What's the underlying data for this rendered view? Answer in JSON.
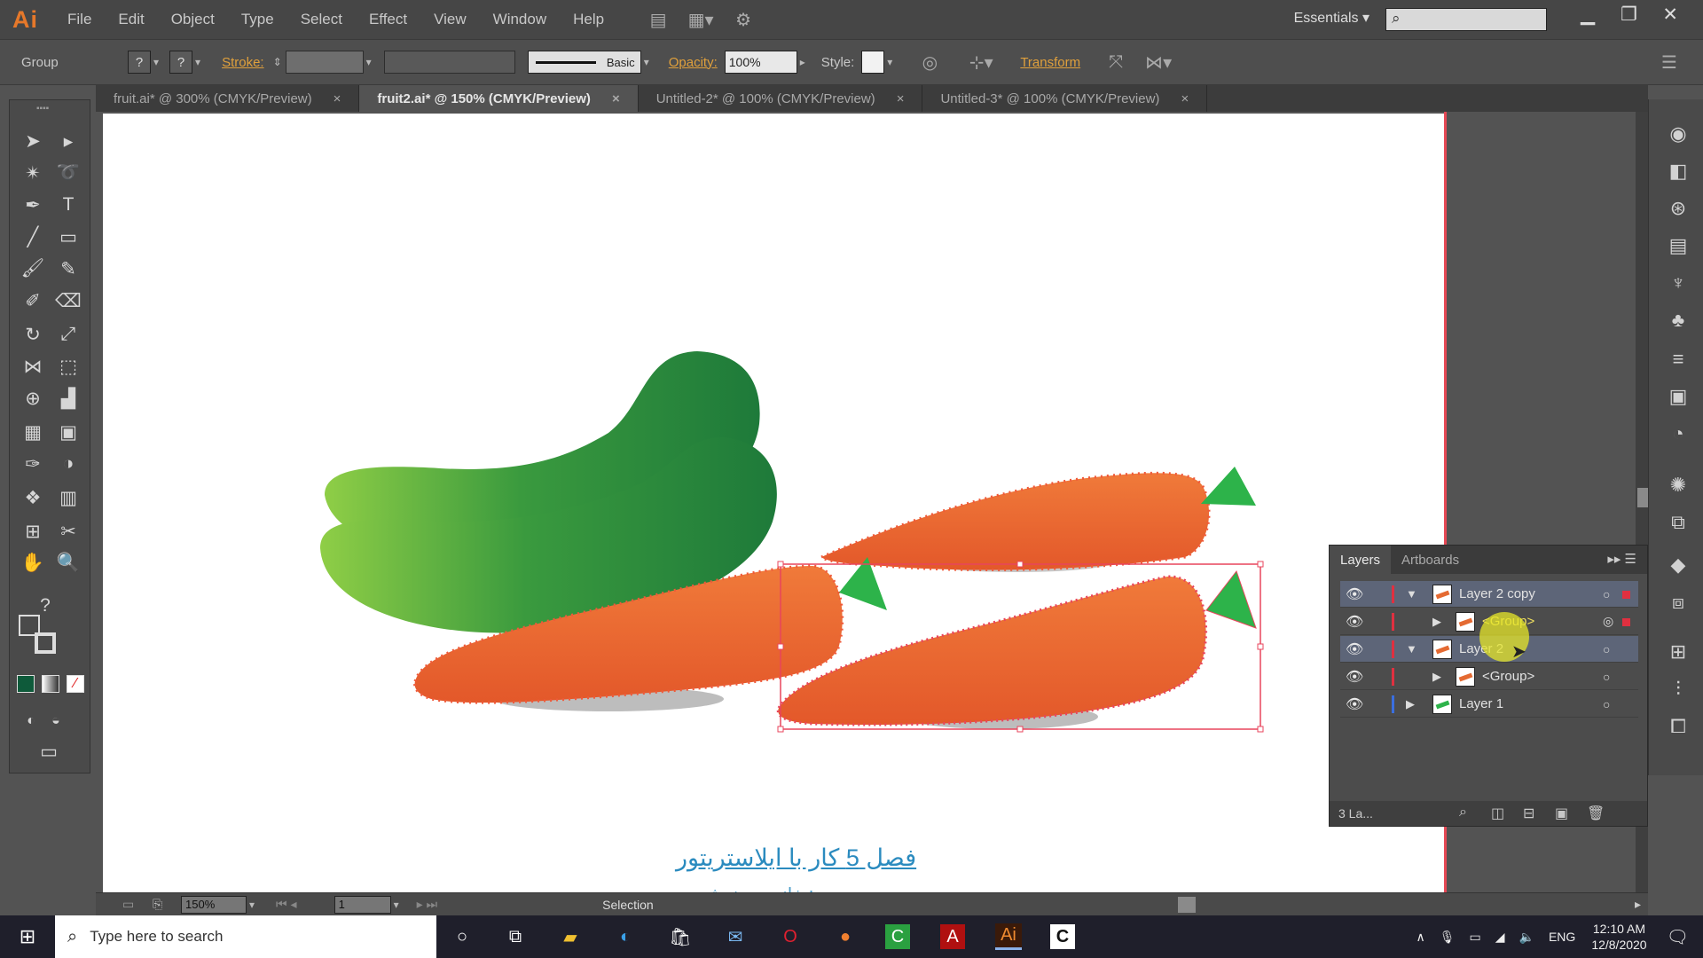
{
  "app": {
    "logo": "Ai",
    "menus": [
      "File",
      "Edit",
      "Object",
      "Type",
      "Select",
      "Effect",
      "View",
      "Window",
      "Help"
    ],
    "workspace": "Essentials",
    "search_placeholder": "",
    "window_controls": [
      "minimize",
      "restore",
      "close"
    ]
  },
  "control_bar": {
    "selection_type": "Group",
    "stroke_label": "Stroke:",
    "brush_label": "Basic",
    "opacity_label": "Opacity:",
    "opacity_value": "100%",
    "style_label": "Style:",
    "transform_label": "Transform"
  },
  "tabs": [
    {
      "label": "fruit.ai* @ 300% (CMYK/Preview)",
      "active": false
    },
    {
      "label": "fruit2.ai* @ 150% (CMYK/Preview)",
      "active": true
    },
    {
      "label": "Untitled-2* @ 100% (CMYK/Preview)",
      "active": false
    },
    {
      "label": "Untitled-3* @ 100% (CMYK/Preview)",
      "active": false
    }
  ],
  "tools": [
    "selection-tool",
    "direct-selection-tool",
    "magic-wand-tool",
    "lasso-tool",
    "pen-tool",
    "type-tool",
    "line-tool",
    "rectangle-tool",
    "paintbrush-tool",
    "pencil-tool",
    "blob-brush-tool",
    "eraser-tool",
    "rotate-tool",
    "scale-tool",
    "width-tool",
    "free-transform-tool",
    "shape-builder-tool",
    "perspective-grid-tool",
    "mesh-tool",
    "gradient-tool",
    "eyedropper-tool",
    "blend-tool",
    "symbol-sprayer-tool",
    "column-graph-tool",
    "artboard-tool",
    "slice-tool",
    "hand-tool",
    "zoom-tool"
  ],
  "colors": {
    "fill": "#0e5a3a",
    "artboard_edge": "#e64855",
    "carrot": "#e8692e",
    "cucumber_dark": "#1e7a3a",
    "cucumber_light": "#8fce46",
    "leaf": "#2db34a",
    "selection": "#e8455c"
  },
  "status": {
    "zoom": "150%",
    "page": "1",
    "mode": "Selection"
  },
  "captions": {
    "title": "فصل 5 کار با ایلاستریتور",
    "subtitle": "مدرس: خانم مهرنوش"
  },
  "layers_panel": {
    "tabs": [
      "Layers",
      "Artboards"
    ],
    "rows": [
      {
        "name": "Layer 2 copy",
        "level": 0,
        "expanded": true,
        "selected": true,
        "color": "#e03040"
      },
      {
        "name": "<Group>",
        "level": 1,
        "expanded": false,
        "selected": false,
        "color": "#e03040"
      },
      {
        "name": "Layer 2",
        "level": 0,
        "expanded": true,
        "selected": true,
        "color": "#e03040"
      },
      {
        "name": "<Group>",
        "level": 1,
        "expanded": false,
        "selected": false,
        "color": "#e03040"
      },
      {
        "name": "Layer 1",
        "level": 0,
        "expanded": false,
        "selected": false,
        "color": "#3a6fe0"
      }
    ],
    "footer_count": "3 La..."
  },
  "taskbar": {
    "search_placeholder": "Type here to search",
    "language": "ENG",
    "time": "12:10 AM",
    "date": "12/8/2020"
  }
}
